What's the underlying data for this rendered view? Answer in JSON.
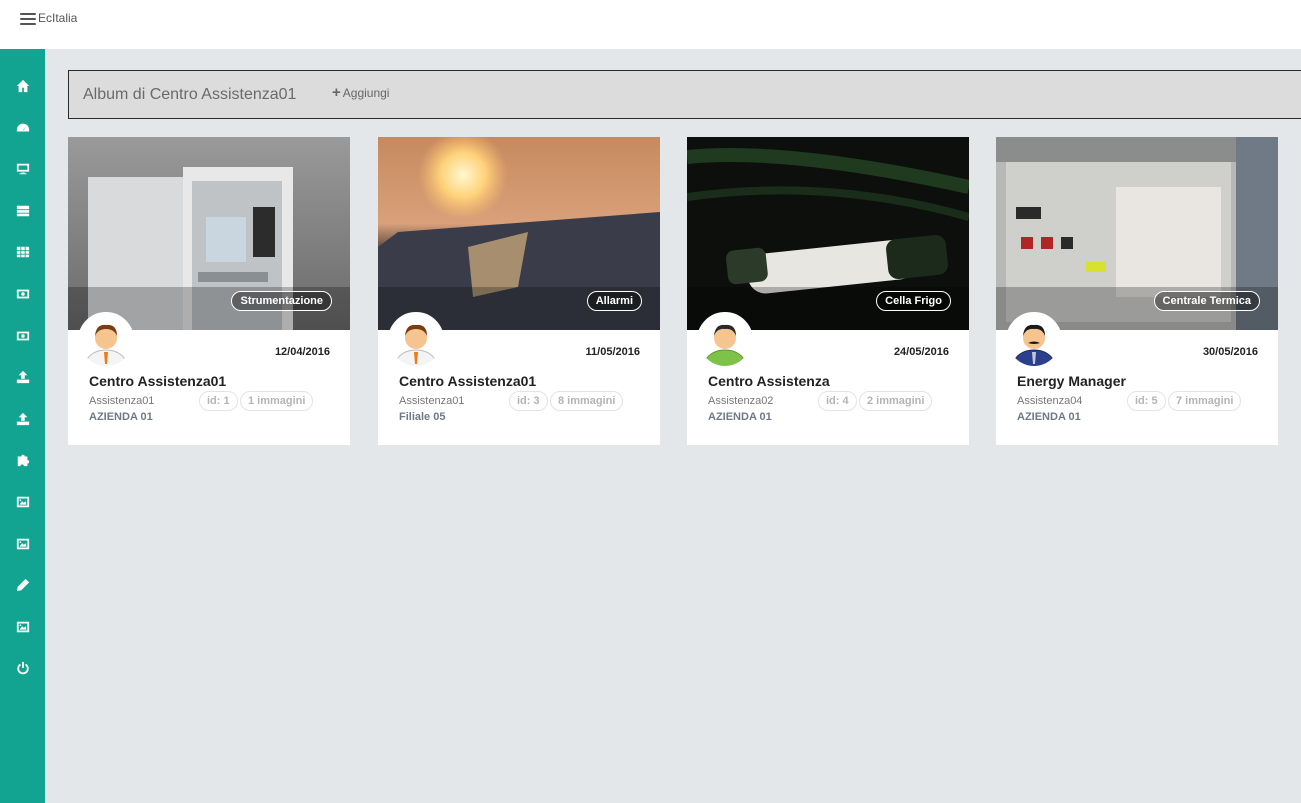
{
  "app": {
    "brand": "EcItalia"
  },
  "sidebar": {
    "items": [
      {
        "icon": "home-icon"
      },
      {
        "icon": "dashboard-icon"
      },
      {
        "icon": "monitor-icon"
      },
      {
        "icon": "server-icon"
      },
      {
        "icon": "grid-icon"
      },
      {
        "icon": "money-icon"
      },
      {
        "icon": "money-icon"
      },
      {
        "icon": "upload-icon"
      },
      {
        "icon": "upload-icon"
      },
      {
        "icon": "puzzle-icon"
      },
      {
        "icon": "image-icon"
      },
      {
        "icon": "image-icon"
      },
      {
        "icon": "pencil-icon"
      },
      {
        "icon": "image-icon"
      },
      {
        "icon": "power-icon"
      }
    ]
  },
  "header": {
    "title": "Album di Centro Assistenza01",
    "add_label": "Aggiungi"
  },
  "cards": [
    {
      "tag": "Strumentazione",
      "date": "12/04/2016",
      "name": "Centro Assistenza01",
      "user": "Assistenza01",
      "company": "AZIENDA 01",
      "id_label": "id: 1",
      "count_label": "1 immagini"
    },
    {
      "tag": "Allarmi",
      "date": "11/05/2016",
      "name": "Centro Assistenza01",
      "user": "Assistenza01",
      "company": "Filiale 05",
      "id_label": "id: 3",
      "count_label": "8 immagini"
    },
    {
      "tag": "Cella Frigo",
      "date": "24/05/2016",
      "name": "Centro Assistenza",
      "user": "Assistenza02",
      "company": "AZIENDA 01",
      "id_label": "id: 4",
      "count_label": "2 immagini"
    },
    {
      "tag": "Centrale Termica",
      "date": "30/05/2016",
      "name": "Energy Manager",
      "user": "Assistenza04",
      "company": "AZIENDA 01",
      "id_label": "id: 5",
      "count_label": "7 immagini"
    }
  ],
  "colors": {
    "sidebar": "#13a491",
    "background": "#e3e7ea"
  }
}
